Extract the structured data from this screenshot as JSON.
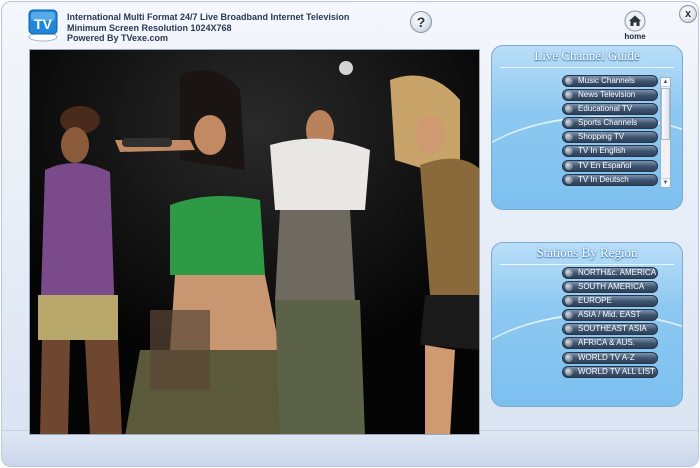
{
  "header": {
    "line1": "International Multi Format 24/7 Live Broadband Internet Television",
    "line2": "Minimum Screen Resolution 1024X768",
    "line3": "Powered By TVexe.com",
    "logo_text": "TV"
  },
  "toolbar": {
    "help_label": "?",
    "home_label": "home",
    "close_label": "x"
  },
  "video": {
    "icon": "live-video-stream"
  },
  "guide": {
    "title": "Live Channel Guide",
    "items": [
      {
        "label": "Music Channels"
      },
      {
        "label": "News Television"
      },
      {
        "label": "Educational TV"
      },
      {
        "label": "Sports Channels"
      },
      {
        "label": "Shopping TV"
      },
      {
        "label": "TV In English"
      },
      {
        "label": "TV En Español"
      },
      {
        "label": "TV In Deutsch"
      }
    ]
  },
  "regions": {
    "title": "Stations By Region",
    "items": [
      {
        "label": "NORTH&c. AMERICA"
      },
      {
        "label": "SOUTH AMERICA"
      },
      {
        "label": "EUROPE"
      },
      {
        "label": "ASIA / Mid. EAST"
      },
      {
        "label": "SOUTHEAST ASIA"
      },
      {
        "label": "AFRICA & AUS."
      },
      {
        "label": "WORLD TV A-Z"
      },
      {
        "label": "WORLD TV ALL LIST"
      }
    ]
  },
  "colors": {
    "panel_blue": "#8dc8f1",
    "button_dark": "#3c516c",
    "frame_bg": "#e4ebf6"
  }
}
